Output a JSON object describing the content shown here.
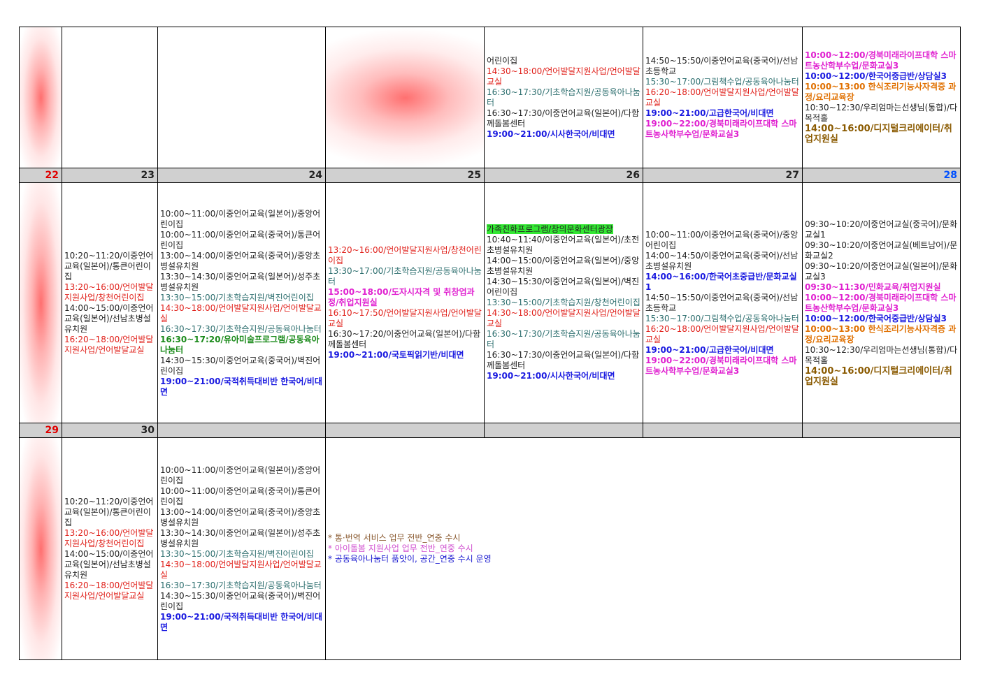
{
  "week1": {
    "wed": [
      {
        "t": "어린이집",
        "c": "black"
      },
      {
        "t": "14:30~18:00/언어발달지원사업/언어발달교실",
        "c": "red"
      },
      {
        "t": "16:30~17:30/기초학습지원/공동육아나눔터",
        "c": "teal"
      },
      {
        "t": "16:30~17:30/이중언어교육(일본어)/다함께돌봄센터",
        "c": "black"
      },
      {
        "t": "19:00~21:00/시사한국어/비대면",
        "c": "blue"
      }
    ],
    "thu": [
      {
        "t": "14:50~15:50/이중언어교육(중국어)/선남초등학교",
        "c": "black"
      },
      {
        "t": "15:30~17:00/그림책수업/공동육아나눔터",
        "c": "teal"
      },
      {
        "t": "16:20~18:00/언어발달지원사업/언어발달교실",
        "c": "red"
      },
      {
        "t": "19:00~21:00/고급한국어/비대면",
        "c": "blue"
      },
      {
        "t": "19:00~22:00/경북미래라이프대학 스마트농사학부수업/문화교실3",
        "c": "magb"
      }
    ],
    "fri": [
      {
        "t": "10:00~12:00/경북미래라이프대학 스마트농산학부수업/문화교실3",
        "c": "magb"
      },
      {
        "t": "10:00~12:00/한국어중급반/상담실3",
        "c": "blue"
      },
      {
        "t": "10:00~13:00 한식조리기능사자격증 과정/요리교육장",
        "c": "orange"
      },
      {
        "t": "10:30~12:30/우리엄마는선생님(통합)/다목적홀",
        "c": "black"
      },
      {
        "t": "14:00~16:00/디지털크리에이터/취업지원실",
        "c": "brown"
      }
    ]
  },
  "week2": {
    "days": [
      "22",
      "23",
      "24",
      "25",
      "26",
      "27",
      "28"
    ],
    "mon": [
      {
        "t": "10:20~11:20/이중언어교육(일본어)/통큰어린이집",
        "c": "black"
      },
      {
        "t": "13:20~16:00/언어발달지원사업/창천어린이집",
        "c": "red"
      },
      {
        "t": "14:00~15:00/이중언어교육(일본어)/선남초병설유치원",
        "c": "black"
      },
      {
        "t": "16:20~18:00/언어발달지원사업/언어발달교실",
        "c": "red"
      }
    ],
    "tue": [
      {
        "t": "10:00~11:00/이중언어교육(일본어)/중앙어린이집",
        "c": "black"
      },
      {
        "t": "10:00~11:00/이중언어교육(중국어)/통큰어린이집",
        "c": "black"
      },
      {
        "t": "13:00~14:00/이중언어교육(중국어)/중앙초병설유치원",
        "c": "black"
      },
      {
        "t": "13:30~14:30/이중언어교육(일본어)/성주초병설유치원",
        "c": "black"
      },
      {
        "t": "13:30~15:00/기초학습지원/벽진어린이집",
        "c": "teal"
      },
      {
        "t": "14:30~18:00/언어발달지원사업/언어발달교실",
        "c": "red"
      },
      {
        "t": "16:30~17:30/기초학습지원/공동육아나눔터",
        "c": "teal"
      },
      {
        "t": "16:30~17:20/유아미술프로그램/공동육아나눔터",
        "c": "green"
      },
      {
        "t": "14:30~15:30/이중언어교육(중국어)/벽진어린이집",
        "c": "black"
      },
      {
        "t": "19:00~21:00/국적취득대비반 한국어/비대면",
        "c": "blue"
      }
    ],
    "wed": [
      {
        "t": "13:20~16:00/언어발달지원사업/창천어린이집",
        "c": "red"
      },
      {
        "t": "13:30~17:00/기초학습지원/공동육아나눔터",
        "c": "teal"
      },
      {
        "t": "15:00~18:00/도자시자격 및 취창업과정/취업지원실",
        "c": "magb"
      },
      {
        "t": "16:10~17:50/언어발달지원사업/언어발달교실",
        "c": "red"
      },
      {
        "t": "16:30~17:20/이중언어교육(일본어)/다함께돌봄센터",
        "c": "black"
      },
      {
        "t": "19:00~21:00/국토픽읽기반/비대면",
        "c": "blue"
      }
    ],
    "thu": [
      {
        "t": "가족친화프로그램/창의문화센터광장",
        "c": "hl"
      },
      {
        "t": "10:40~11:40/이중언어교육(일본어)/초전초병설유치원",
        "c": "black"
      },
      {
        "t": "14:00~15:00/이중언어교육(일본어)/중앙초병설유치원",
        "c": "black"
      },
      {
        "t": "14:30~15:30/이중언어교육(일본어)/벽진어린이집",
        "c": "black"
      },
      {
        "t": "13:30~15:00/기초학습지원/창천어린이집",
        "c": "teal"
      },
      {
        "t": "14:30~18:00/언어발달지원사업/언어발달교실",
        "c": "red"
      },
      {
        "t": "16:30~17:30/기초학습지원/공동육아나눔터",
        "c": "teal"
      },
      {
        "t": "16:30~17:30/이중언어교육(일본어)/다함께돌봄센터",
        "c": "black"
      },
      {
        "t": "19:00~21:00/시사한국어/비대면",
        "c": "blue"
      }
    ],
    "fri": [
      {
        "t": "10:00~11:00/이중언어교육(중국어)/중앙어린이집",
        "c": "black"
      },
      {
        "t": "14:00~14:50/이중언어교육(중국어)/선남초병설유치원",
        "c": "black"
      },
      {
        "t": "14:00~16:00/한국어초중급반/문화교실1",
        "c": "blue"
      },
      {
        "t": "14:50~15:50/이중언어교육(중국어)/선남초등학교",
        "c": "black"
      },
      {
        "t": "15:30~17:00/그림책수업/공동육아나눔터",
        "c": "teal"
      },
      {
        "t": "16:20~18:00/언어발달지원사업/언어발달교실",
        "c": "red"
      },
      {
        "t": "19:00~21:00/고급한국어/비대면",
        "c": "blue"
      },
      {
        "t": "19:00~22:00/경북미래라이프대학 스마트농사학부수업/문화교실3",
        "c": "magb"
      }
    ],
    "sat": [
      {
        "t": "09:30~10:20/이중언어교실(중국어)/문화교실1",
        "c": "black"
      },
      {
        "t": "09:30~10:20/이중언어교실(베트남어)/문화교실2",
        "c": "black"
      },
      {
        "t": "09:30~10:20/이중언어교실(일본어)/문화교실3",
        "c": "black"
      },
      {
        "t": "09:30~11:30/민화교육/취업지원실",
        "c": "magb"
      },
      {
        "t": "10:00~12:00/경북미래라이프대학 스마트농산학부수업/문화교실3",
        "c": "magb"
      },
      {
        "t": "10:00~12:00/한국어중급반/상담실3",
        "c": "blue"
      },
      {
        "t": "10:00~13:00 한식조리기능사자격증 과정/요리교육장",
        "c": "orange"
      },
      {
        "t": "10:30~12:30/우리엄마는선생님(통합)/다목적홀",
        "c": "black"
      },
      {
        "t": "14:00~16:00/디지털크리에이터/취업지원실",
        "c": "brown"
      }
    ]
  },
  "week3": {
    "days": [
      "29",
      "30"
    ],
    "mon": [
      {
        "t": "10:20~11:20/이중언어교육(일본어)/통큰어린이집",
        "c": "black"
      },
      {
        "t": "13:20~16:00/언어발달지원사업/창천어린이집",
        "c": "red"
      },
      {
        "t": "14:00~15:00/이중언어교육(일본어)/선남초병설유치원",
        "c": "black"
      },
      {
        "t": "16:20~18:00/언어발달지원사업/언어발달교실",
        "c": "red"
      }
    ],
    "tue": [
      {
        "t": "10:00~11:00/이중언어교육(일본어)/중앙어린이집",
        "c": "black"
      },
      {
        "t": "10:00~11:00/이중언어교육(중국어)/통큰어린이집",
        "c": "black"
      },
      {
        "t": "13:00~14:00/이중언어교육(중국어)/중앙초병설유치원",
        "c": "black"
      },
      {
        "t": "13:30~14:30/이중언어교육(일본어)/성주초병설유치원",
        "c": "black"
      },
      {
        "t": "13:30~15:00/기초학습지원/벽진어린이집",
        "c": "teal"
      },
      {
        "t": "14:30~18:00/언어발달지원사업/언어발달교실",
        "c": "red"
      },
      {
        "t": "16:30~17:30/기초학습지원/공동육아나눔터",
        "c": "teal"
      },
      {
        "t": "14:30~15:30/이중언어교육(중국어)/벽진어린이집",
        "c": "black"
      },
      {
        "t": "19:00~21:00/국적취득대비반 한국어/비대면",
        "c": "blue"
      }
    ],
    "notes": [
      "* 통·번역 서비스 업무 전반_연중 수시",
      "* 아이돌봄 지원사업 업무 전반_연중 수시",
      "* 공동육아나눔터 품앗이, 공간_연중 수시 운영"
    ]
  }
}
